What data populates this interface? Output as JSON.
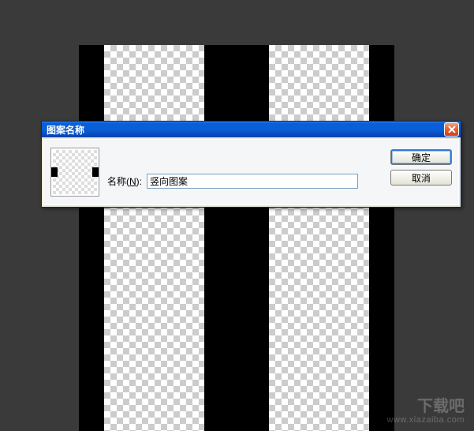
{
  "canvas": {
    "strip1": "transparent-checker",
    "strip2": "transparent-checker"
  },
  "dialog": {
    "title": "图案名称",
    "name_label_prefix": "名称(",
    "name_label_underline": "N",
    "name_label_suffix": "):",
    "name_value": "竖向图案",
    "ok_label": "确定",
    "cancel_label": "取消",
    "close_icon": "close-icon"
  },
  "watermark": {
    "main": "下载吧",
    "sub": "www.xiazaiba.com"
  }
}
